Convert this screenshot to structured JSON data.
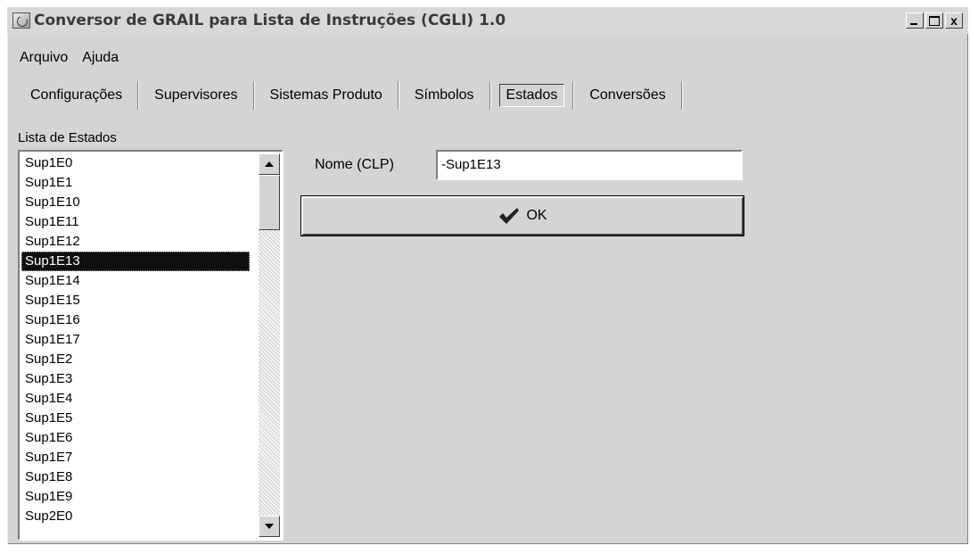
{
  "window": {
    "title": "Conversor de GRAIL para Lista de Instruções (CGLI) 1.0",
    "controls": {
      "minimize": "_",
      "maximize": "□",
      "close": "x"
    }
  },
  "menu": [
    "Arquivo",
    "Ajuda"
  ],
  "tabs": [
    {
      "label": "Configurações",
      "active": false
    },
    {
      "label": "Supervisores",
      "active": false
    },
    {
      "label": "Sistemas Produto",
      "active": false
    },
    {
      "label": "Símbolos",
      "active": false
    },
    {
      "label": "Estados",
      "active": true
    },
    {
      "label": "Conversões",
      "active": false
    }
  ],
  "states_list": {
    "label": "Lista de Estados",
    "items": [
      "Sup1E0",
      "Sup1E1",
      "Sup1E10",
      "Sup1E11",
      "Sup1E12",
      "Sup1E13",
      "Sup1E14",
      "Sup1E15",
      "Sup1E16",
      "Sup1E17",
      "Sup1E2",
      "Sup1E3",
      "Sup1E4",
      "Sup1E5",
      "Sup1E6",
      "Sup1E7",
      "Sup1E8",
      "Sup1E9",
      "Sup2E0"
    ],
    "selected": "Sup1E13"
  },
  "name_field": {
    "label": "Nome (CLP)",
    "value": "-Sup1E13"
  },
  "ok_button": {
    "label": "OK",
    "icon": "checkmark-icon"
  }
}
